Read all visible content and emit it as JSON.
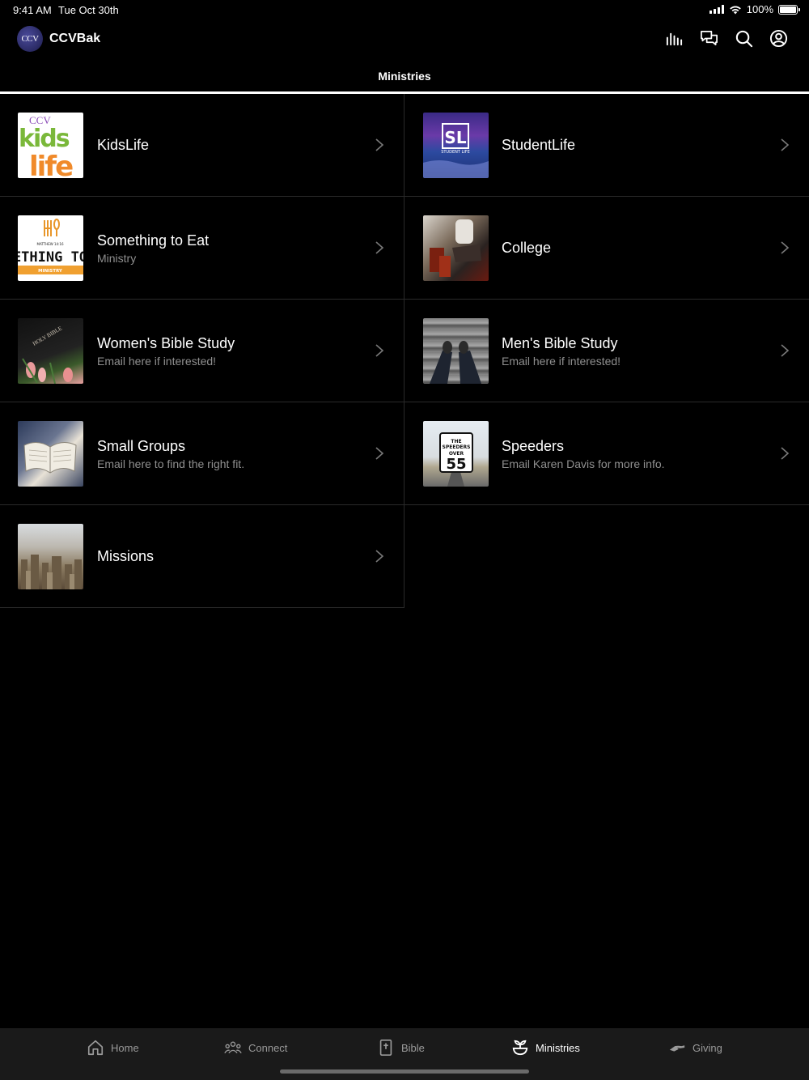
{
  "status": {
    "time": "9:41 AM",
    "date": "Tue Oct 30th",
    "battery": "100%"
  },
  "header": {
    "app_title": "CCVBak",
    "logo_text": "CCV"
  },
  "tabs": {
    "active_label": "Ministries"
  },
  "ministries": [
    {
      "title": "KidsLife",
      "subtitle": ""
    },
    {
      "title": "StudentLife",
      "subtitle": ""
    },
    {
      "title": "Something to Eat",
      "subtitle": "Ministry"
    },
    {
      "title": "College",
      "subtitle": ""
    },
    {
      "title": "Women's Bible Study",
      "subtitle": "Email here if interested!"
    },
    {
      "title": "Men's Bible Study",
      "subtitle": "Email here if interested!"
    },
    {
      "title": "Small Groups",
      "subtitle": "Email here to find the right fit."
    },
    {
      "title": "Speeders",
      "subtitle": "Email Karen Davis for more info."
    },
    {
      "title": "Missions",
      "subtitle": ""
    }
  ],
  "thumbs": {
    "kids_top": "CCV",
    "kids_mid": "kids",
    "kids_bot": "life",
    "student": "SL",
    "student_sub": "STUDENT LIFE",
    "eat_main": "ETHING TO",
    "eat_band": "MINISTRY",
    "eat_small": "MATTHEW 14:16",
    "womens": "HOLY BIBLE",
    "speed_the": "THE",
    "speed_word": "SPEEDERS",
    "speed_over": "OVER",
    "speed_num": "55"
  },
  "bottom_nav": {
    "home": "Home",
    "connect": "Connect",
    "bible": "Bible",
    "ministries": "Ministries",
    "giving": "Giving"
  }
}
